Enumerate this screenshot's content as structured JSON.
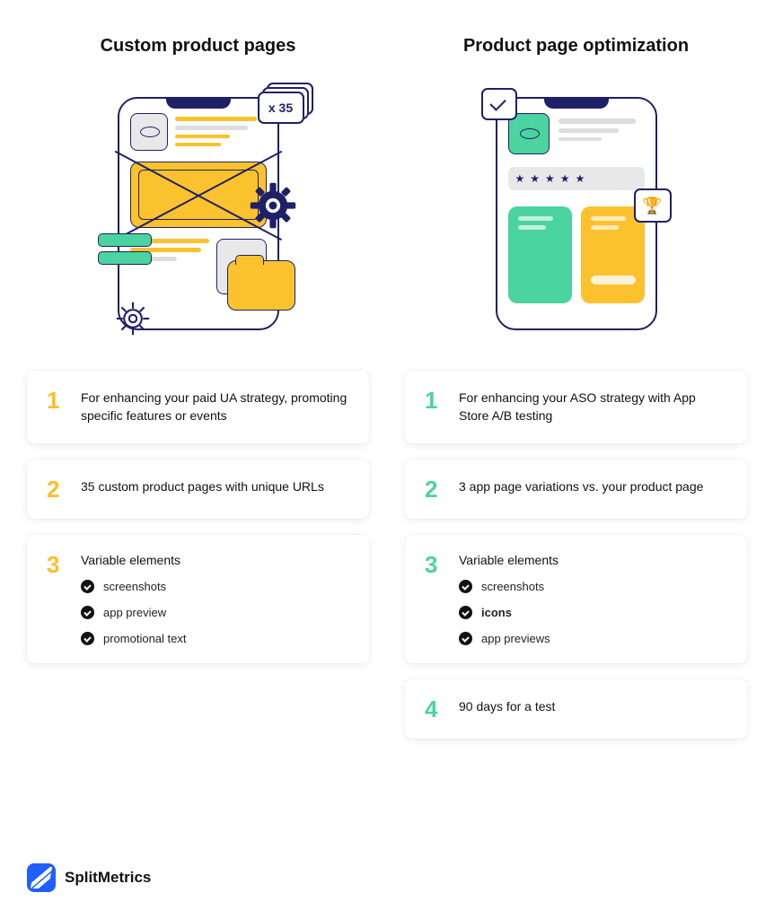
{
  "left": {
    "title": "Custom product pages",
    "badge": "x 35",
    "cards": [
      {
        "num": "1",
        "text": "For enhancing your paid UA strategy, promoting specific features or events"
      },
      {
        "num": "2",
        "text": "35 custom product pages with unique URLs"
      },
      {
        "num": "3",
        "title": "Variable elements",
        "items": [
          {
            "label": "screenshots",
            "bold": false
          },
          {
            "label": "app preview",
            "bold": false
          },
          {
            "label": "promotional text",
            "bold": false
          }
        ]
      }
    ]
  },
  "right": {
    "title": "Product page optimization",
    "cards": [
      {
        "num": "1",
        "text": "For enhancing your ASO strategy with App Store A/B testing"
      },
      {
        "num": "2",
        "text": "3 app page variations vs. your product page"
      },
      {
        "num": "3",
        "title": "Variable elements",
        "items": [
          {
            "label": "screenshots",
            "bold": false
          },
          {
            "label": "icons",
            "bold": true
          },
          {
            "label": "app previews",
            "bold": false
          }
        ]
      },
      {
        "num": "4",
        "text": "90 days for a test"
      }
    ]
  },
  "brand": "SplitMetrics"
}
